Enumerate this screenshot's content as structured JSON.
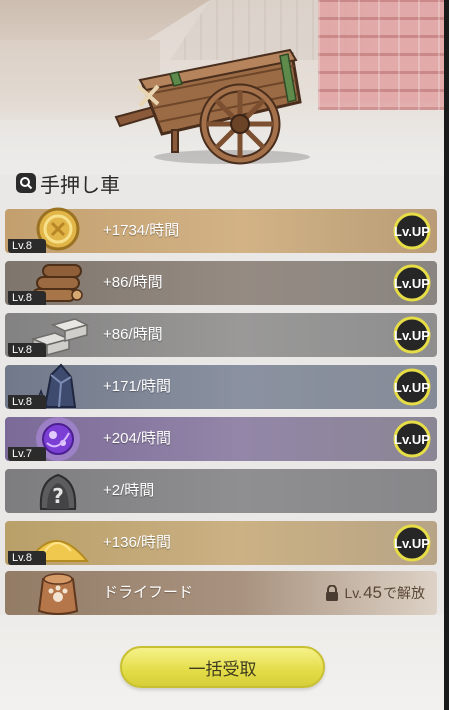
{
  "title": "手押し車",
  "rows": [
    {
      "level": "Lv.8",
      "rate": "+1734/時間",
      "upgrade": "Lv.UP",
      "resource": "gold-coin"
    },
    {
      "level": "Lv.8",
      "rate": "+86/時間",
      "upgrade": "Lv.UP",
      "resource": "wood-logs"
    },
    {
      "level": "Lv.8",
      "rate": "+86/時間",
      "upgrade": "Lv.UP",
      "resource": "stone-blocks"
    },
    {
      "level": "Lv.8",
      "rate": "+171/時間",
      "upgrade": "Lv.UP",
      "resource": "crystal"
    },
    {
      "level": "Lv.7",
      "rate": "+204/時間",
      "upgrade": "Lv.UP",
      "resource": "magic-orb"
    },
    {
      "level": "",
      "rate": "+2/時間",
      "upgrade": "",
      "resource": "mystery-item"
    },
    {
      "level": "Lv.8",
      "rate": "+136/時間",
      "upgrade": "Lv.UP",
      "resource": "sand-pile"
    },
    {
      "level": "",
      "rate": "ドライフード",
      "upgrade": "",
      "resource": "food-sack"
    }
  ],
  "locked": {
    "prefix": "Lv.",
    "level": "45",
    "suffix": "で解放"
  },
  "collect_button": "一括受取",
  "colors": {
    "gold": "#c8a777",
    "wood": "#8b8179",
    "stone": "#8d8c8b",
    "crystal": "#7f8696",
    "magic": "#8b7aa3",
    "mystery": "#88888a",
    "sand": "#c4a770",
    "food": "#9c8875",
    "button": "#e3dc48"
  }
}
